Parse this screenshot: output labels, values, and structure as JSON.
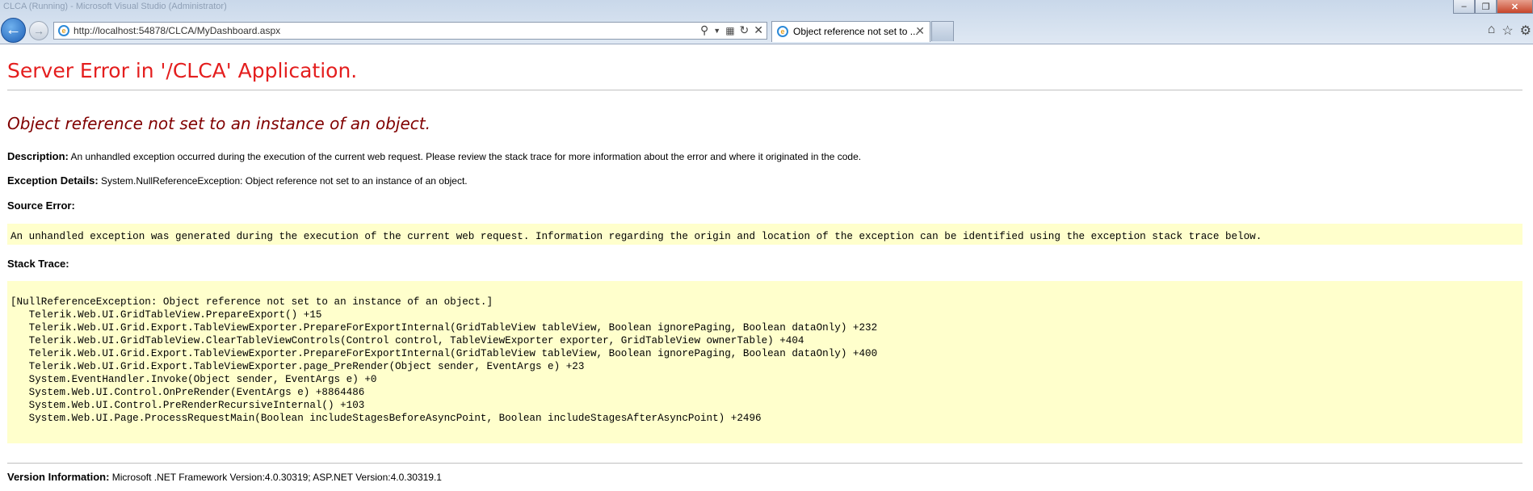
{
  "browser": {
    "window_title": "CLCA (Running) - Microsoft Visual Studio (Administrator)",
    "url": "http://localhost:54878/CLCA/MyDashboard.aspx",
    "tab_title": "Object reference not set to ...",
    "window_controls": {
      "minimize": "–",
      "restore": "❒",
      "close": "✕"
    }
  },
  "page": {
    "title": "Server Error in '/CLCA' Application.",
    "subtitle": "Object reference not set to an instance of an object.",
    "description_label": "Description:",
    "description_text": "An unhandled exception occurred during the execution of the current web request. Please review the stack trace for more information about the error and where it originated in the code.",
    "exception_label": "Exception Details:",
    "exception_text": "System.NullReferenceException: Object reference not set to an instance of an object.",
    "source_error_label": "Source Error:",
    "source_error_text": "An unhandled exception was generated during the execution of the current web request. Information regarding the origin and location of the exception can be identified using the exception stack trace below.",
    "stack_trace_label": "Stack Trace:",
    "stack_trace": [
      "[NullReferenceException: Object reference not set to an instance of an object.]",
      "   Telerik.Web.UI.GridTableView.PrepareExport() +15",
      "   Telerik.Web.UI.Grid.Export.TableViewExporter.PrepareForExportInternal(GridTableView tableView, Boolean ignorePaging, Boolean dataOnly) +232",
      "   Telerik.Web.UI.GridTableView.ClearTableViewControls(Control control, TableViewExporter exporter, GridTableView ownerTable) +404",
      "   Telerik.Web.UI.Grid.Export.TableViewExporter.PrepareForExportInternal(GridTableView tableView, Boolean ignorePaging, Boolean dataOnly) +400",
      "   Telerik.Web.UI.Grid.Export.TableViewExporter.page_PreRender(Object sender, EventArgs e) +23",
      "   System.EventHandler.Invoke(Object sender, EventArgs e) +0",
      "   System.Web.UI.Control.OnPreRender(EventArgs e) +8864486",
      "   System.Web.UI.Control.PreRenderRecursiveInternal() +103",
      "   System.Web.UI.Page.ProcessRequestMain(Boolean includeStagesBeforeAsyncPoint, Boolean includeStagesAfterAsyncPoint) +2496"
    ],
    "version_label": "Version Information:",
    "version_text": "Microsoft .NET Framework Version:4.0.30319; ASP.NET Version:4.0.30319.1"
  },
  "icons": [
    "back-arrow-icon",
    "forward-arrow-icon",
    "ie-page-icon",
    "search-icon",
    "dropdown-icon",
    "compatibility-icon",
    "refresh-icon",
    "stop-icon",
    "tab-close-icon",
    "home-icon",
    "favorites-star-icon",
    "tools-gear-icon"
  ],
  "colors": {
    "title_red": "#e41e1e",
    "subtitle_maroon": "#800000",
    "code_bg": "#ffffcc",
    "chrome_blue": "#c9d8ea"
  }
}
